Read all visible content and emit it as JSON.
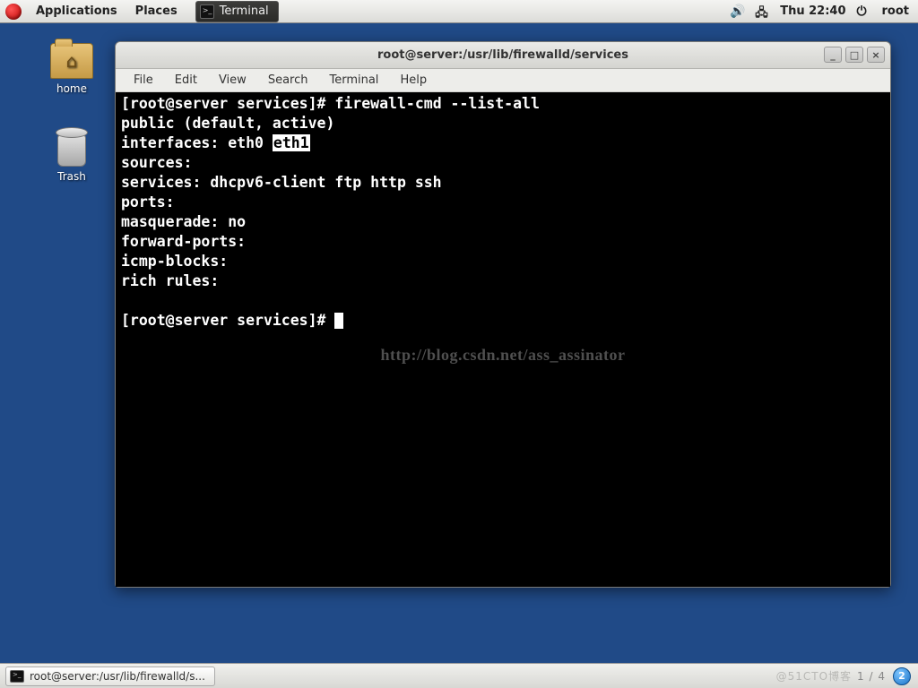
{
  "top_panel": {
    "applications": "Applications",
    "places": "Places",
    "task_button_label": "Terminal",
    "clock": "Thu 22:40",
    "user": "root"
  },
  "desktop": {
    "home_label": "home",
    "trash_label": "Trash"
  },
  "window": {
    "title": "root@server:/usr/lib/firewalld/services",
    "menu": {
      "file": "File",
      "edit": "Edit",
      "view": "View",
      "search": "Search",
      "terminal": "Terminal",
      "help": "Help"
    },
    "controls": {
      "min": "_",
      "max": "□",
      "close": "×"
    }
  },
  "terminal": {
    "prompt1_prefix": "[root@server services]# ",
    "command1": "firewall-cmd --list-all",
    "line_zone": "public (default, active)",
    "line_iface_prefix": "  interfaces: eth0 ",
    "line_iface_hl": "eth1",
    "line_sources": "  sources:",
    "line_services": "  services: dhcpv6-client ftp http ssh",
    "line_ports": "  ports:",
    "line_masq": "  masquerade: no",
    "line_fwd": "  forward-ports:",
    "line_icmp": "  icmp-blocks:",
    "line_rich": "  rich rules:",
    "prompt2_prefix": "[root@server services]# "
  },
  "watermark": "http://blog.csdn.net/ass_assinator",
  "bottom_panel": {
    "task_label": "root@server:/usr/lib/firewalld/s...",
    "faint": "@51CTO博客",
    "pager": "1 / 4",
    "workspace": "2"
  }
}
